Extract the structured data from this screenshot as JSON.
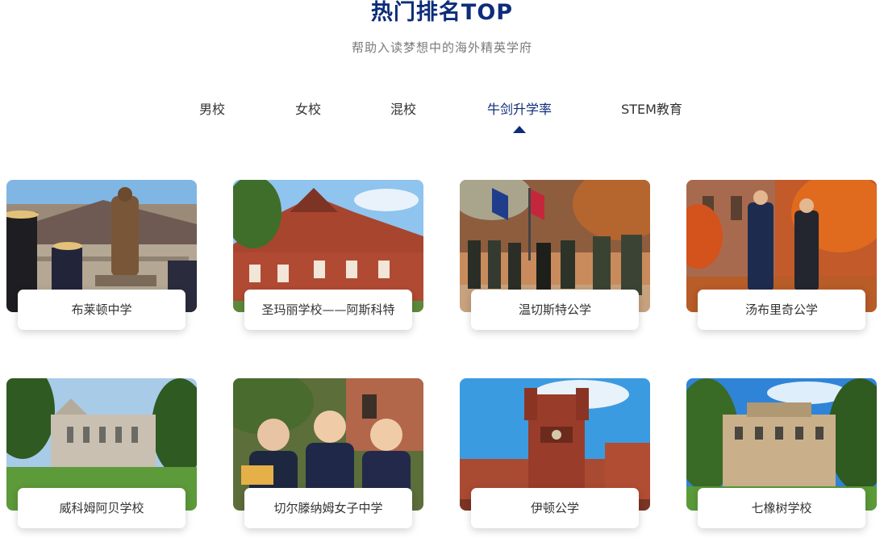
{
  "header": {
    "title": "热门排名TOP",
    "subtitle": "帮助入读梦想中的海外精英学府"
  },
  "tabs": [
    {
      "label": "男校",
      "active": false
    },
    {
      "label": "女校",
      "active": false
    },
    {
      "label": "混校",
      "active": false
    },
    {
      "label": "牛剑升学率",
      "active": true
    },
    {
      "label": "STEM教育",
      "active": false
    }
  ],
  "schools": [
    {
      "name": "布莱顿中学",
      "icon": "statue-photo"
    },
    {
      "name": "圣玛丽学校——阿斯科特",
      "icon": "red-brick-school-photo"
    },
    {
      "name": "温切斯特公学",
      "icon": "cadet-parade-photo"
    },
    {
      "name": "汤布里奇公学",
      "icon": "students-autumn-photo"
    },
    {
      "name": "威科姆阿贝学校",
      "icon": "gothic-abbey-photo"
    },
    {
      "name": "切尔滕纳姆女子中学",
      "icon": "girls-students-photo"
    },
    {
      "name": "伊顿公学",
      "icon": "eton-tower-photo"
    },
    {
      "name": "七橡树学校",
      "icon": "georgian-house-photo"
    }
  ],
  "colors": {
    "accent": "#0d2d7a",
    "subtitle": "#7a7a7a",
    "text": "#333333"
  }
}
